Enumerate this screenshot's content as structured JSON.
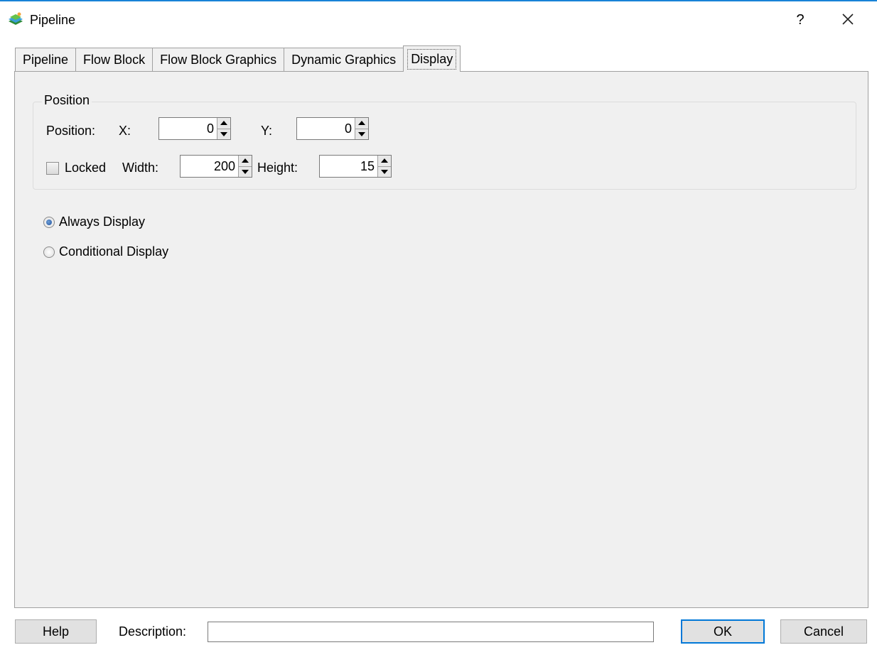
{
  "window": {
    "title": "Pipeline",
    "help_glyph": "?",
    "icon": "app-icon",
    "accent_color": "#1883d7"
  },
  "tabs": [
    {
      "label": "Pipeline",
      "active": false
    },
    {
      "label": "Flow Block",
      "active": false
    },
    {
      "label": "Flow Block Graphics",
      "active": false
    },
    {
      "label": "Dynamic Graphics",
      "active": false
    },
    {
      "label": "Display",
      "active": true
    }
  ],
  "position_group": {
    "title": "Position",
    "position_label": "Position:",
    "x_label": "X:",
    "x_value": "0",
    "y_label": "Y:",
    "y_value": "0",
    "locked_label": "Locked",
    "locked_checked": false,
    "width_label": "Width:",
    "width_value": "200",
    "height_label": "Height:",
    "height_value": "15"
  },
  "display_mode": {
    "options": [
      {
        "label": "Always Display",
        "checked": true
      },
      {
        "label": "Conditional Display",
        "checked": false
      }
    ]
  },
  "footer": {
    "help_label": "Help",
    "description_label": "Description:",
    "description_value": "",
    "ok_label": "OK",
    "cancel_label": "Cancel"
  }
}
